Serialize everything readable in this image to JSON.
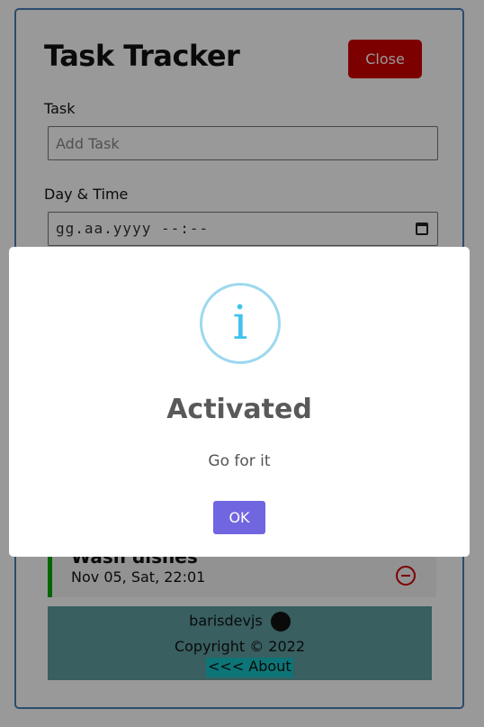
{
  "app": {
    "title": "Task Tracker",
    "close_label": "Close"
  },
  "form": {
    "task_label": "Task",
    "task_placeholder": "Add Task",
    "day_label": "Day & Time",
    "day_value": "gg.aa.yyyy --:--"
  },
  "task": {
    "name": "Wash dishes",
    "date": "Nov 05, Sat, 22:01"
  },
  "footer": {
    "author": "barisdevjs",
    "copyright": "Copyright © 2022",
    "about_link": "<<< About"
  },
  "modal": {
    "icon": "i",
    "title": "Activated",
    "text": "Go for it",
    "ok_label": "OK"
  },
  "colors": {
    "close_button": "#d10000",
    "task_border": "#00aa00",
    "footer_bg": "#5f9ea0",
    "ok_button": "#7066e0",
    "info_icon": "#3fc3ee"
  }
}
